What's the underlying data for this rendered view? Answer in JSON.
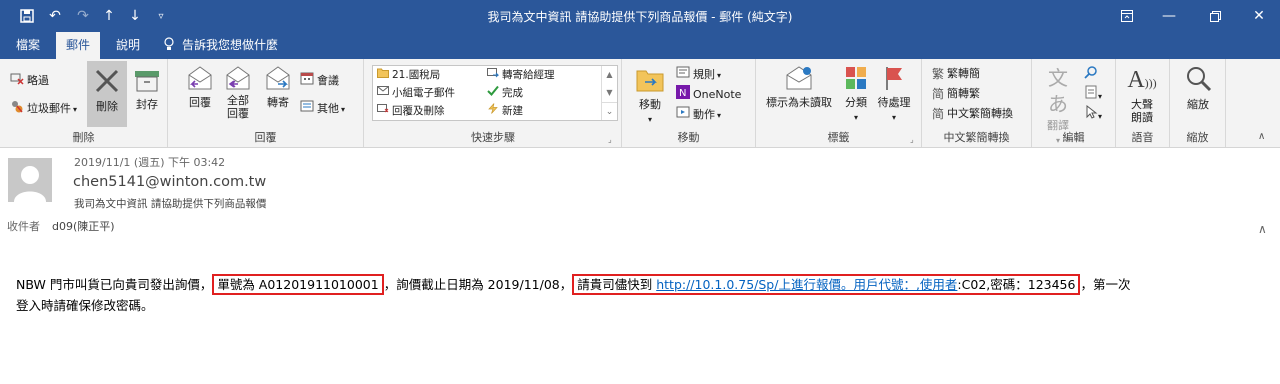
{
  "window": {
    "title": "我司為文中資訊 請協助提供下列商品報價 - 郵件 (純文字)"
  },
  "tabs": [
    "檔案",
    "郵件",
    "說明"
  ],
  "tell_me": "告訴我您想做什麼",
  "ribbon": {
    "delete_group": {
      "label": "刪除",
      "ignore": "略過",
      "junk": "垃圾郵件",
      "delete": "刪除",
      "archive": "封存"
    },
    "respond_group": {
      "label": "回覆",
      "reply": "回覆",
      "reply_all_1": "全部",
      "reply_all_2": "回覆",
      "forward": "轉寄",
      "meeting": "會議",
      "more": "其他"
    },
    "quick_steps": {
      "label": "快速步驟",
      "items": [
        "21.國稅局",
        "轉寄給經理",
        "小組電子郵件",
        "完成",
        "回覆及刪除",
        "新建"
      ]
    },
    "move_group": {
      "label": "移動",
      "move": "移動",
      "rules": "規則",
      "onenote": "OneNote",
      "actions": "動作"
    },
    "tags_group": {
      "label": "標籤",
      "mark_unread": "標示為未讀取",
      "categorize": "分類",
      "follow_up": "待處理"
    },
    "chinese_group": {
      "label": "中文繁簡轉換",
      "t2s": "繁轉簡",
      "s2t": "簡轉繁",
      "convert": "中文繁簡轉換"
    },
    "editing_group": {
      "label": "編輯",
      "translate": "翻譯"
    },
    "speech_group": {
      "label": "語音",
      "read_aloud_1": "大聲",
      "read_aloud_2": "朗讀"
    },
    "zoom_group": {
      "label": "縮放",
      "zoom": "縮放"
    }
  },
  "message": {
    "date": "2019/11/1 (週五) 下午 03:42",
    "sender": "chen5141@winton.com.tw",
    "subject": "我司為文中資訊 請協助提供下列商品報價",
    "to_label": "收件者",
    "to_value": "d09(陳正平)",
    "body": {
      "part1": "NBW 門市叫貨已向貴司發出詢價，",
      "box1": "單號為 A01201911010001",
      "part2": "，詢價截止日期為 2019/11/08，",
      "box2_text": "請貴司儘快到 ",
      "box2_link": "http://10.1.0.75/Sp/上進行報價。用戶代號：,使用者",
      "box2_tail": ":C02,密碼：123456",
      "part3": "，第一次",
      "line2": "登入時請確保修改密碼。"
    }
  }
}
